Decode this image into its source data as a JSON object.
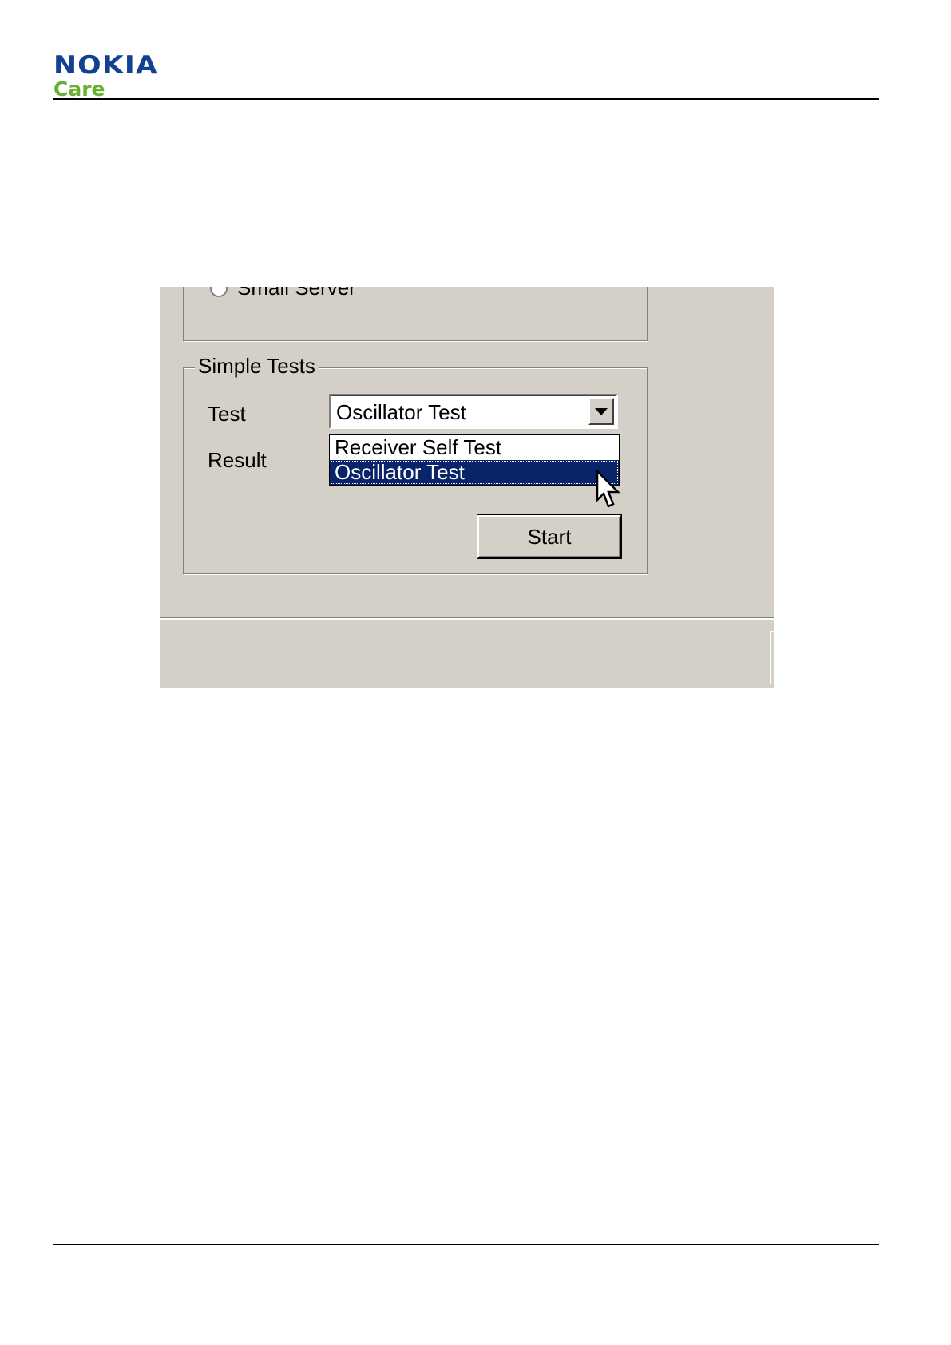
{
  "header": {
    "logo_brand": "NOKIA",
    "logo_sub": "Care",
    "colors": {
      "brand_blue": "#124191",
      "care_green": "#66b032"
    }
  },
  "screenshot": {
    "top_group": {
      "radio_label": "Small Server"
    },
    "simple_tests": {
      "legend": "Simple Tests",
      "test_label": "Test",
      "result_label": "Result",
      "combo_value": "Oscillator Test",
      "dropdown_options": [
        "Receiver Self Test",
        "Oscillator Test"
      ],
      "selected_index": 1,
      "start_button_label": "Start"
    },
    "colors": {
      "face": "#d4d0c8",
      "selection": "#0a246a"
    },
    "icons": {
      "combo_arrow": "chevron-down-icon",
      "pointer": "mouse-pointer-icon"
    }
  }
}
